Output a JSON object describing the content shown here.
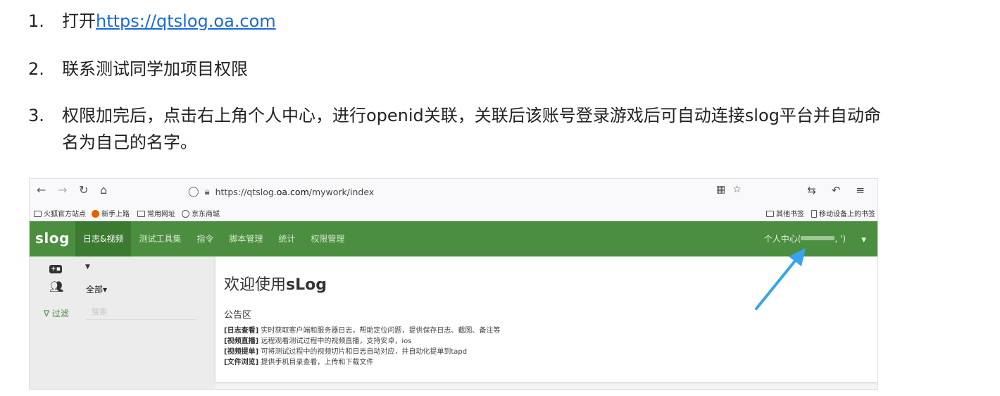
{
  "steps": [
    {
      "num": "1.",
      "text": "打开",
      "link": "https://qtslog.oa.com"
    },
    {
      "num": "2.",
      "text": "联系测试同学加项目权限"
    },
    {
      "num": "3.",
      "text": "权限加完后，点击右上角个人中心，进行openid关联，关联后该账号登录游戏后可自动连接slog平台并自动命名为自己的名字。"
    }
  ],
  "browser": {
    "url_prefix": "https://qtslog.",
    "url_domain": "oa.com",
    "url_path": "/mywork/index",
    "bookmarks": [
      "火狐官方站点",
      "新手上路",
      "常用网址",
      "京东商城"
    ],
    "bookmarks_right": [
      "其他书签",
      "移动设备上的书签"
    ]
  },
  "app": {
    "brand": "slog",
    "menu": [
      "日志&视频",
      "测试工具集",
      "指令",
      "脚本管理",
      "统计",
      "权限管理"
    ],
    "active_menu": 0,
    "user_prefix": "个人中心(",
    "user_suffix": ", ')"
  },
  "sidebar": {
    "all_label": "全部▾",
    "filter_label": "∇ 过滤",
    "search_placeholder": "搜索"
  },
  "main": {
    "welcome_prefix": "欢迎使用",
    "welcome_brand": "sLog",
    "announcement_title": "公告区",
    "lines": [
      {
        "tag": "[日志查看]",
        "text": " 实时获取客户端和服务器日志，帮助定位问题，提供保存日志、截图、备注等"
      },
      {
        "tag": "[视频直播]",
        "text": " 远程观看测试过程中的视频直播，支持安卓，ios"
      },
      {
        "tag": "[视频提单]",
        "text": " 可将测试过程中的视频切片和日志自动对应，并自动化提单到tapd"
      },
      {
        "tag": "[文件浏览]",
        "text": " 提供手机目录查看，上传和下载文件"
      }
    ]
  },
  "colors": {
    "nav_green": "#4b8e3f",
    "arrow_blue": "#3aa3f0",
    "link_blue": "#1a6ad8"
  }
}
